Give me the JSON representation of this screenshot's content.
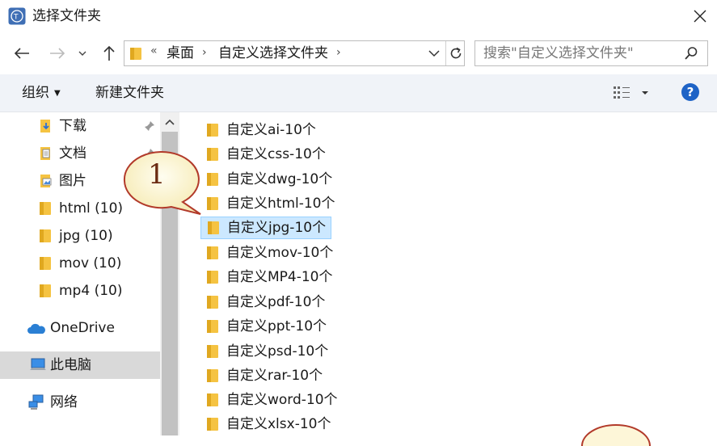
{
  "window": {
    "title": "选择文件夹"
  },
  "address": {
    "overflow": "«",
    "crumbs": [
      "桌面",
      "自定义选择文件夹"
    ],
    "sep": "›"
  },
  "search": {
    "placeholder": "搜索\"自定义选择文件夹\""
  },
  "toolbar": {
    "organize_label": "组织",
    "new_folder_label": "新建文件夹",
    "help_label": "?"
  },
  "sidebar": {
    "items": [
      {
        "label": "下载",
        "icon": "download-folder-icon",
        "pinned": true
      },
      {
        "label": "文档",
        "icon": "documents-folder-icon",
        "pinned": true
      },
      {
        "label": "图片",
        "icon": "pictures-folder-icon",
        "pinned": false
      },
      {
        "label": "html (10)",
        "icon": "folder-icon"
      },
      {
        "label": "jpg (10)",
        "icon": "folder-icon"
      },
      {
        "label": "mov (10)",
        "icon": "folder-icon"
      },
      {
        "label": "mp4 (10)",
        "icon": "folder-icon"
      },
      {
        "label": "OneDrive",
        "icon": "onedrive-icon"
      },
      {
        "label": "此电脑",
        "icon": "this-pc-icon",
        "selected": true
      },
      {
        "label": "网络",
        "icon": "network-icon"
      }
    ]
  },
  "files": {
    "items": [
      {
        "label": "自定义ai-10个"
      },
      {
        "label": "自定义css-10个"
      },
      {
        "label": "自定义dwg-10个"
      },
      {
        "label": "自定义html-10个"
      },
      {
        "label": "自定义jpg-10个",
        "selected": true
      },
      {
        "label": "自定义mov-10个"
      },
      {
        "label": "自定义MP4-10个"
      },
      {
        "label": "自定义pdf-10个"
      },
      {
        "label": "自定义ppt-10个"
      },
      {
        "label": "自定义psd-10个"
      },
      {
        "label": "自定义rar-10个"
      },
      {
        "label": "自定义word-10个"
      },
      {
        "label": "自定义xlsx-10个"
      }
    ]
  },
  "annotation": {
    "label": "1"
  },
  "colors": {
    "folder_yellow": "#f5c342",
    "selection_blue": "#cce8ff",
    "help_blue": "#1e63c6",
    "callout_fill": "#fdf6d8",
    "callout_border": "#b23a2a"
  }
}
